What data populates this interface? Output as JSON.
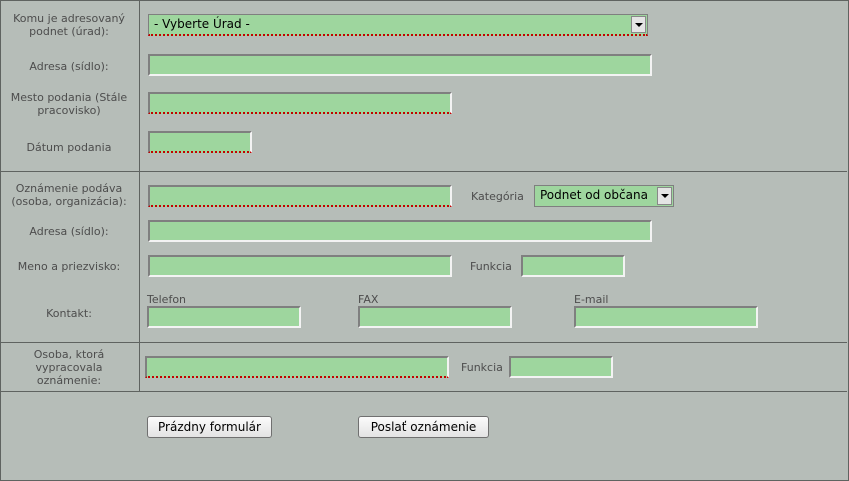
{
  "section_urad": {
    "komu_label": "Komu je adresovaný podnet (úrad):",
    "urad_select": "- Vyberte Úrad -",
    "adresa_label": "Adresa (sídlo):",
    "adresa_value": "",
    "mesto_label": "Mesto podania (Stále pracovisko)",
    "mesto_value": "",
    "datum_label": "Dátum podania",
    "datum_value": ""
  },
  "section_oznamovatel": {
    "podava_label": "Oznámenie podáva (osoba, organizácia):",
    "podava_value": "",
    "kategoria_label": "Kategória",
    "kategoria_select": "Podnet od občana",
    "adresa_label": "Adresa (sídlo):",
    "adresa_value": "",
    "meno_label": "Meno a priezvisko:",
    "meno_value": "",
    "funkcia_label": "Funkcia",
    "funkcia_value": "",
    "kontakt_label": "Kontakt:",
    "telefon_label": "Telefon",
    "telefon_value": "",
    "fax_label": "FAX",
    "fax_value": "",
    "email_label": "E-mail",
    "email_value": ""
  },
  "section_vypracoval": {
    "osoba_label": "Osoba, ktorá vypracovala oznámenie:",
    "osoba_value": "",
    "funkcia_label": "Funkcia",
    "funkcia_value": ""
  },
  "actions": {
    "clear_button": "Prázdny formulár",
    "submit_button": "Poslať oznámenie"
  }
}
